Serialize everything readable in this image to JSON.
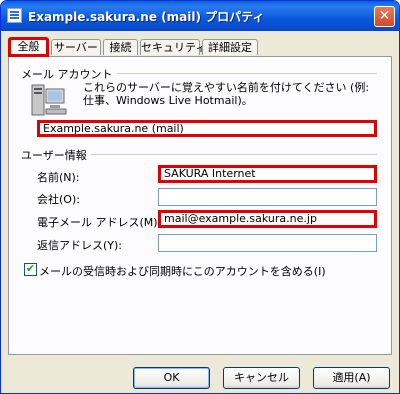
{
  "window": {
    "title": "Example.sakura.ne (mail) プロパティ",
    "close_glyph": "✕"
  },
  "tabs": [
    {
      "label": "全般",
      "active": true
    },
    {
      "label": "サーバー"
    },
    {
      "label": "接続"
    },
    {
      "label": "セキュリティ"
    },
    {
      "label": "詳細設定"
    }
  ],
  "mail_account": {
    "group_label": "メール アカウント",
    "description": "これらのサーバーに覚えやすい名前を付けてください (例: 仕事、Windows Live Hotmail)。",
    "account_name": "Example.sakura.ne (mail)"
  },
  "user_info": {
    "group_label": "ユーザー情報",
    "fields": [
      {
        "label": "名前(N):",
        "value": "SAKURA Internet"
      },
      {
        "label": "会社(O):",
        "value": ""
      },
      {
        "label": "電子メール アドレス(M):",
        "value": "mail@example.sakura.ne.jp"
      },
      {
        "label": "返信アドレス(Y):",
        "value": ""
      }
    ]
  },
  "include_account_checkbox": {
    "label": "メールの受信時および同期時にこのアカウントを含める(I)",
    "checked": true,
    "check_glyph": "✔"
  },
  "buttons": {
    "ok": "OK",
    "cancel": "キャンセル",
    "apply": "適用(A)"
  },
  "colors": {
    "highlight": "#e00000",
    "titlebar": "#0a58dc"
  }
}
